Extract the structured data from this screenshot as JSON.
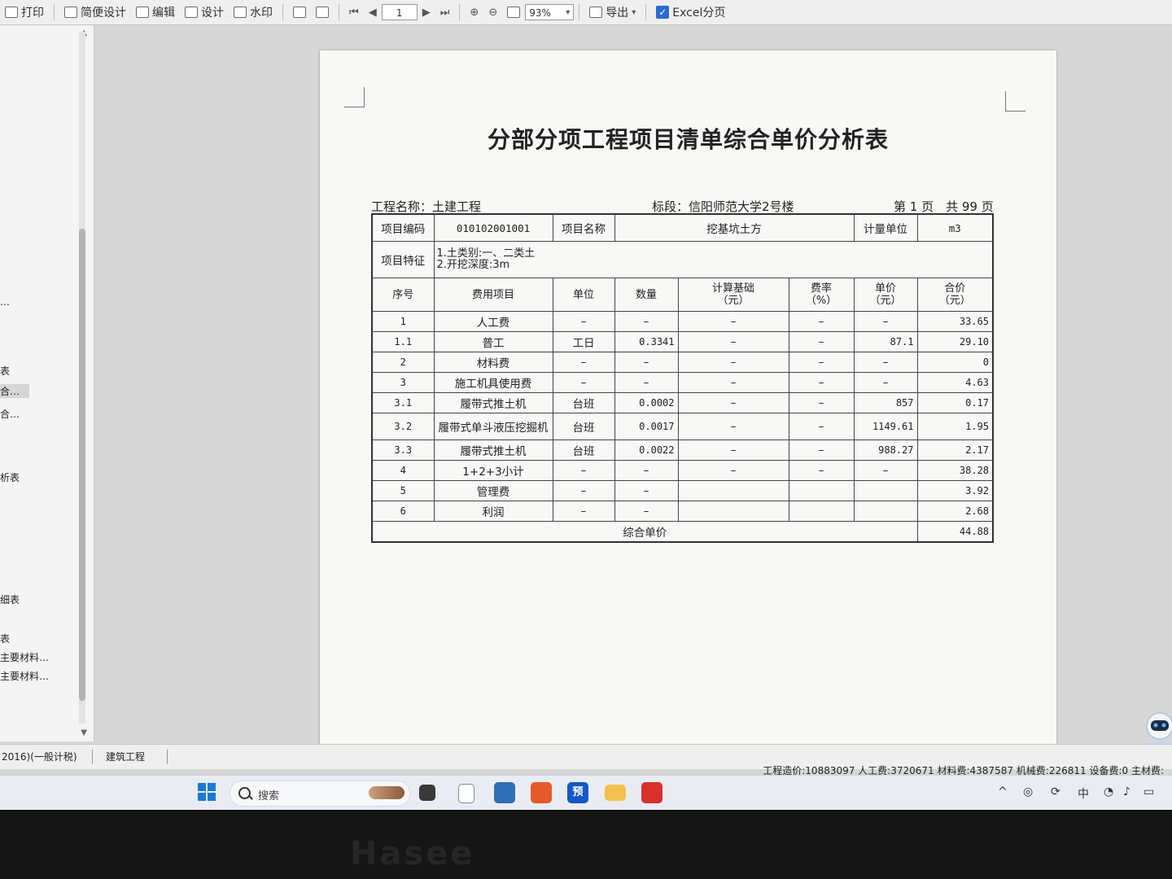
{
  "toolbar": {
    "print": "打印",
    "simple_design": "简便设计",
    "edit": "编辑",
    "design": "设计",
    "watermark": "水印",
    "page_number": "1",
    "zoom": "93%",
    "export": "导出",
    "excel_paging": "Excel分页"
  },
  "sidebar": {
    "items": [
      "…",
      "表",
      "合…",
      "合…",
      "析表",
      "细表",
      "表",
      "主要材料…",
      "主要材料…"
    ]
  },
  "document": {
    "title": "分部分项工程项目清单综合单价分析表",
    "project_label": "工程名称：土建工程",
    "section_label": "标段：信阳师范大学2号楼",
    "page_label": "第 1 页　共 99 页",
    "item_code_label": "项目编码",
    "item_code": "010102001001",
    "item_name_label": "项目名称",
    "item_name": "挖基坑土方",
    "unit_label": "计量单位",
    "unit": "m3",
    "feature_label": "项目特征",
    "features": [
      "1.土类别:一、二类土",
      "2.开挖深度:3m"
    ],
    "columns": [
      "序号",
      "费用项目",
      "单位",
      "数量",
      "计算基础\n（元）",
      "费率\n（%）",
      "单价\n（元）",
      "合价\n（元）"
    ],
    "rows": [
      [
        "1",
        "人工费",
        "–",
        "–",
        "–",
        "–",
        "–",
        "33.65"
      ],
      [
        "1.1",
        "普工",
        "工日",
        "0.3341",
        "–",
        "–",
        "87.1",
        "29.10"
      ],
      [
        "2",
        "材料费",
        "–",
        "–",
        "–",
        "–",
        "–",
        "0"
      ],
      [
        "3",
        "施工机具使用费",
        "–",
        "–",
        "–",
        "–",
        "–",
        "4.63"
      ],
      [
        "3.1",
        "履带式推土机",
        "台班",
        "0.0002",
        "–",
        "–",
        "857",
        "0.17"
      ],
      [
        "3.2",
        "履带式单斗液压挖掘机",
        "台班",
        "0.0017",
        "–",
        "–",
        "1149.61",
        "1.95"
      ],
      [
        "3.3",
        "履带式推土机",
        "台班",
        "0.0022",
        "–",
        "–",
        "988.27",
        "2.17"
      ],
      [
        "4",
        "1+2+3小计",
        "–",
        "–",
        "–",
        "–",
        "–",
        "38.28"
      ],
      [
        "5",
        "管理费",
        "–",
        "–",
        "",
        "",
        "",
        "3.92"
      ],
      [
        "6",
        "利润",
        "–",
        "–",
        "",
        "",
        "",
        "2.68"
      ]
    ],
    "total_label": "综合单价",
    "total_value": "44.88"
  },
  "statusbar": {
    "left": "2016)(一般计税)",
    "tab": "建筑工程"
  },
  "footer_summary": "工程造价:10883097  人工费:3720671  材料费:4387587  机械费:226811  设备费:0  主材费:",
  "taskbar": {
    "search_placeholder": "搜索",
    "app_label": "预",
    "ime": "中"
  },
  "bezel": {
    "brand": "Hasee"
  }
}
